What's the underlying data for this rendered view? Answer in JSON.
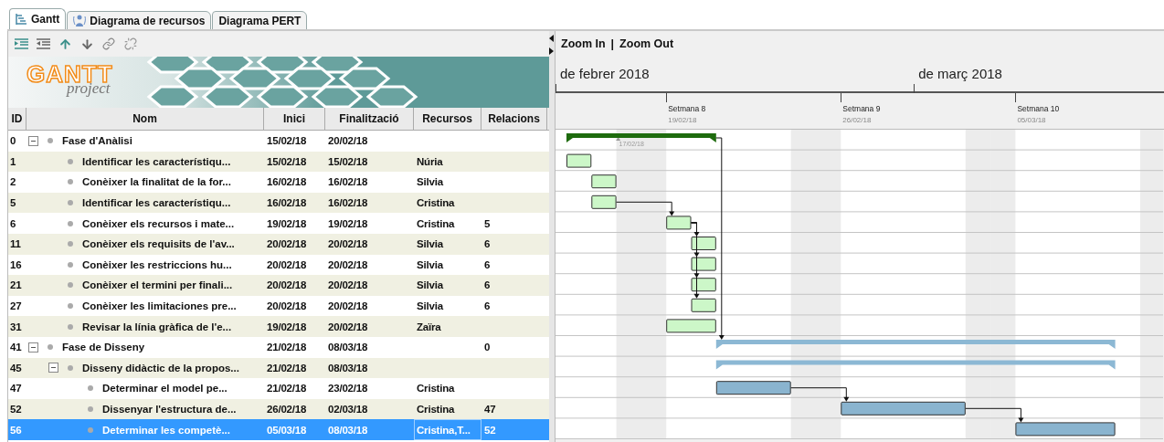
{
  "tabs": [
    {
      "label": "Gantt",
      "kind": "gantt",
      "selected": true
    },
    {
      "label": "Diagrama de recursos",
      "kind": "resources",
      "selected": false
    },
    {
      "label": "Diagrama PERT",
      "kind": "pert",
      "selected": false
    }
  ],
  "logo": {
    "title": "GANTT",
    "subtitle": "project"
  },
  "columns": [
    "ID",
    "Nom",
    "Inici",
    "Finalització",
    "Recursos",
    "Relacions"
  ],
  "rows": [
    {
      "id": "0",
      "name": "Fase d'Anàlisi",
      "start": "15/02/18",
      "end": "20/02/18",
      "kind": "summary",
      "expanded": true,
      "selected": false,
      "color": "#1e6b0e",
      "children": [
        {
          "id": "1",
          "name": "Identificar les característiqu...",
          "start": "15/02/18",
          "end": "15/02/18",
          "resources": "Núria",
          "kind": "task",
          "selected": false,
          "color": "#ccf7c8"
        },
        {
          "id": "2",
          "name": "Conèixer la finalitat de la for...",
          "start": "16/02/18",
          "end": "16/02/18",
          "resources": "Silvia",
          "kind": "task",
          "selected": false,
          "color": "#ccf7c8"
        },
        {
          "id": "5",
          "name": "Identificar les característiqu...",
          "start": "16/02/18",
          "end": "16/02/18",
          "resources": "Cristina",
          "kind": "task",
          "selected": false,
          "color": "#ccf7c8"
        },
        {
          "id": "6",
          "name": "Conèixer els recursos i mate...",
          "start": "19/02/18",
          "end": "19/02/18",
          "resources": "Cristina",
          "relations": "5",
          "kind": "task",
          "selected": false,
          "color": "#ccf7c8"
        },
        {
          "id": "11",
          "name": "Conèixer els requisits de l'av...",
          "start": "20/02/18",
          "end": "20/02/18",
          "resources": "Silvia",
          "relations": "6",
          "kind": "task",
          "selected": false,
          "color": "#ccf7c8"
        },
        {
          "id": "16",
          "name": "Conèixer les restriccions hu...",
          "start": "20/02/18",
          "end": "20/02/18",
          "resources": "Silvia",
          "relations": "6",
          "kind": "task",
          "selected": false,
          "color": "#ccf7c8"
        },
        {
          "id": "21",
          "name": "Conèixer el termini per finali...",
          "start": "20/02/18",
          "end": "20/02/18",
          "resources": "Silvia",
          "relations": "6",
          "kind": "task",
          "selected": false,
          "color": "#ccf7c8"
        },
        {
          "id": "27",
          "name": "Conèixer les limitaciones pre...",
          "start": "20/02/18",
          "end": "20/02/18",
          "resources": "Silvia",
          "relations": "6",
          "kind": "task",
          "selected": false,
          "color": "#ccf7c8"
        },
        {
          "id": "31",
          "name": "Revisar la línia gràfica de l'e...",
          "start": "19/02/18",
          "end": "20/02/18",
          "resources": "Zaïra",
          "kind": "task",
          "selected": false,
          "color": "#ccf7c8"
        }
      ]
    },
    {
      "id": "41",
      "name": "Fase de Disseny",
      "start": "21/02/18",
      "end": "08/03/18",
      "relations": "0",
      "kind": "summary",
      "expanded": true,
      "selected": false,
      "color": "#8cb8d4",
      "children": [
        {
          "id": "45",
          "name": "Disseny didàctic de la propos...",
          "start": "21/02/18",
          "end": "08/03/18",
          "kind": "summary",
          "expanded": true,
          "selected": false,
          "color": "#8cb8d4",
          "children": [
            {
              "id": "47",
              "name": "Determinar el model pe...",
              "start": "21/02/18",
              "end": "23/02/18",
              "resources": "Cristina",
              "kind": "task",
              "selected": false,
              "color": "#8ab4cf"
            },
            {
              "id": "52",
              "name": "Dissenyar l'estructura de...",
              "start": "26/02/18",
              "end": "02/03/18",
              "resources": "Cristina",
              "relations": "47",
              "kind": "task",
              "selected": false,
              "color": "#8ab4cf"
            },
            {
              "id": "56",
              "name": "Determinar les competè...",
              "start": "05/03/18",
              "end": "08/03/18",
              "resources": "Cristina,T...",
              "relations": "52",
              "kind": "task",
              "selected": true,
              "color": "#8ab4cf"
            }
          ]
        }
      ]
    }
  ],
  "zoom": {
    "zoom_in": "Zoom In",
    "separator": "|",
    "zoom_out": "Zoom Out"
  },
  "months": [
    "de febrer 2018",
    "de març 2018"
  ],
  "weeks": [
    {
      "label": "Setmana 8",
      "date": "19/02/18"
    },
    {
      "label": "Setmana 9",
      "date": "26/02/18"
    },
    {
      "label": "Setmana 10",
      "date": "05/03/18"
    }
  ],
  "marker": {
    "date": "17/02/18"
  }
}
